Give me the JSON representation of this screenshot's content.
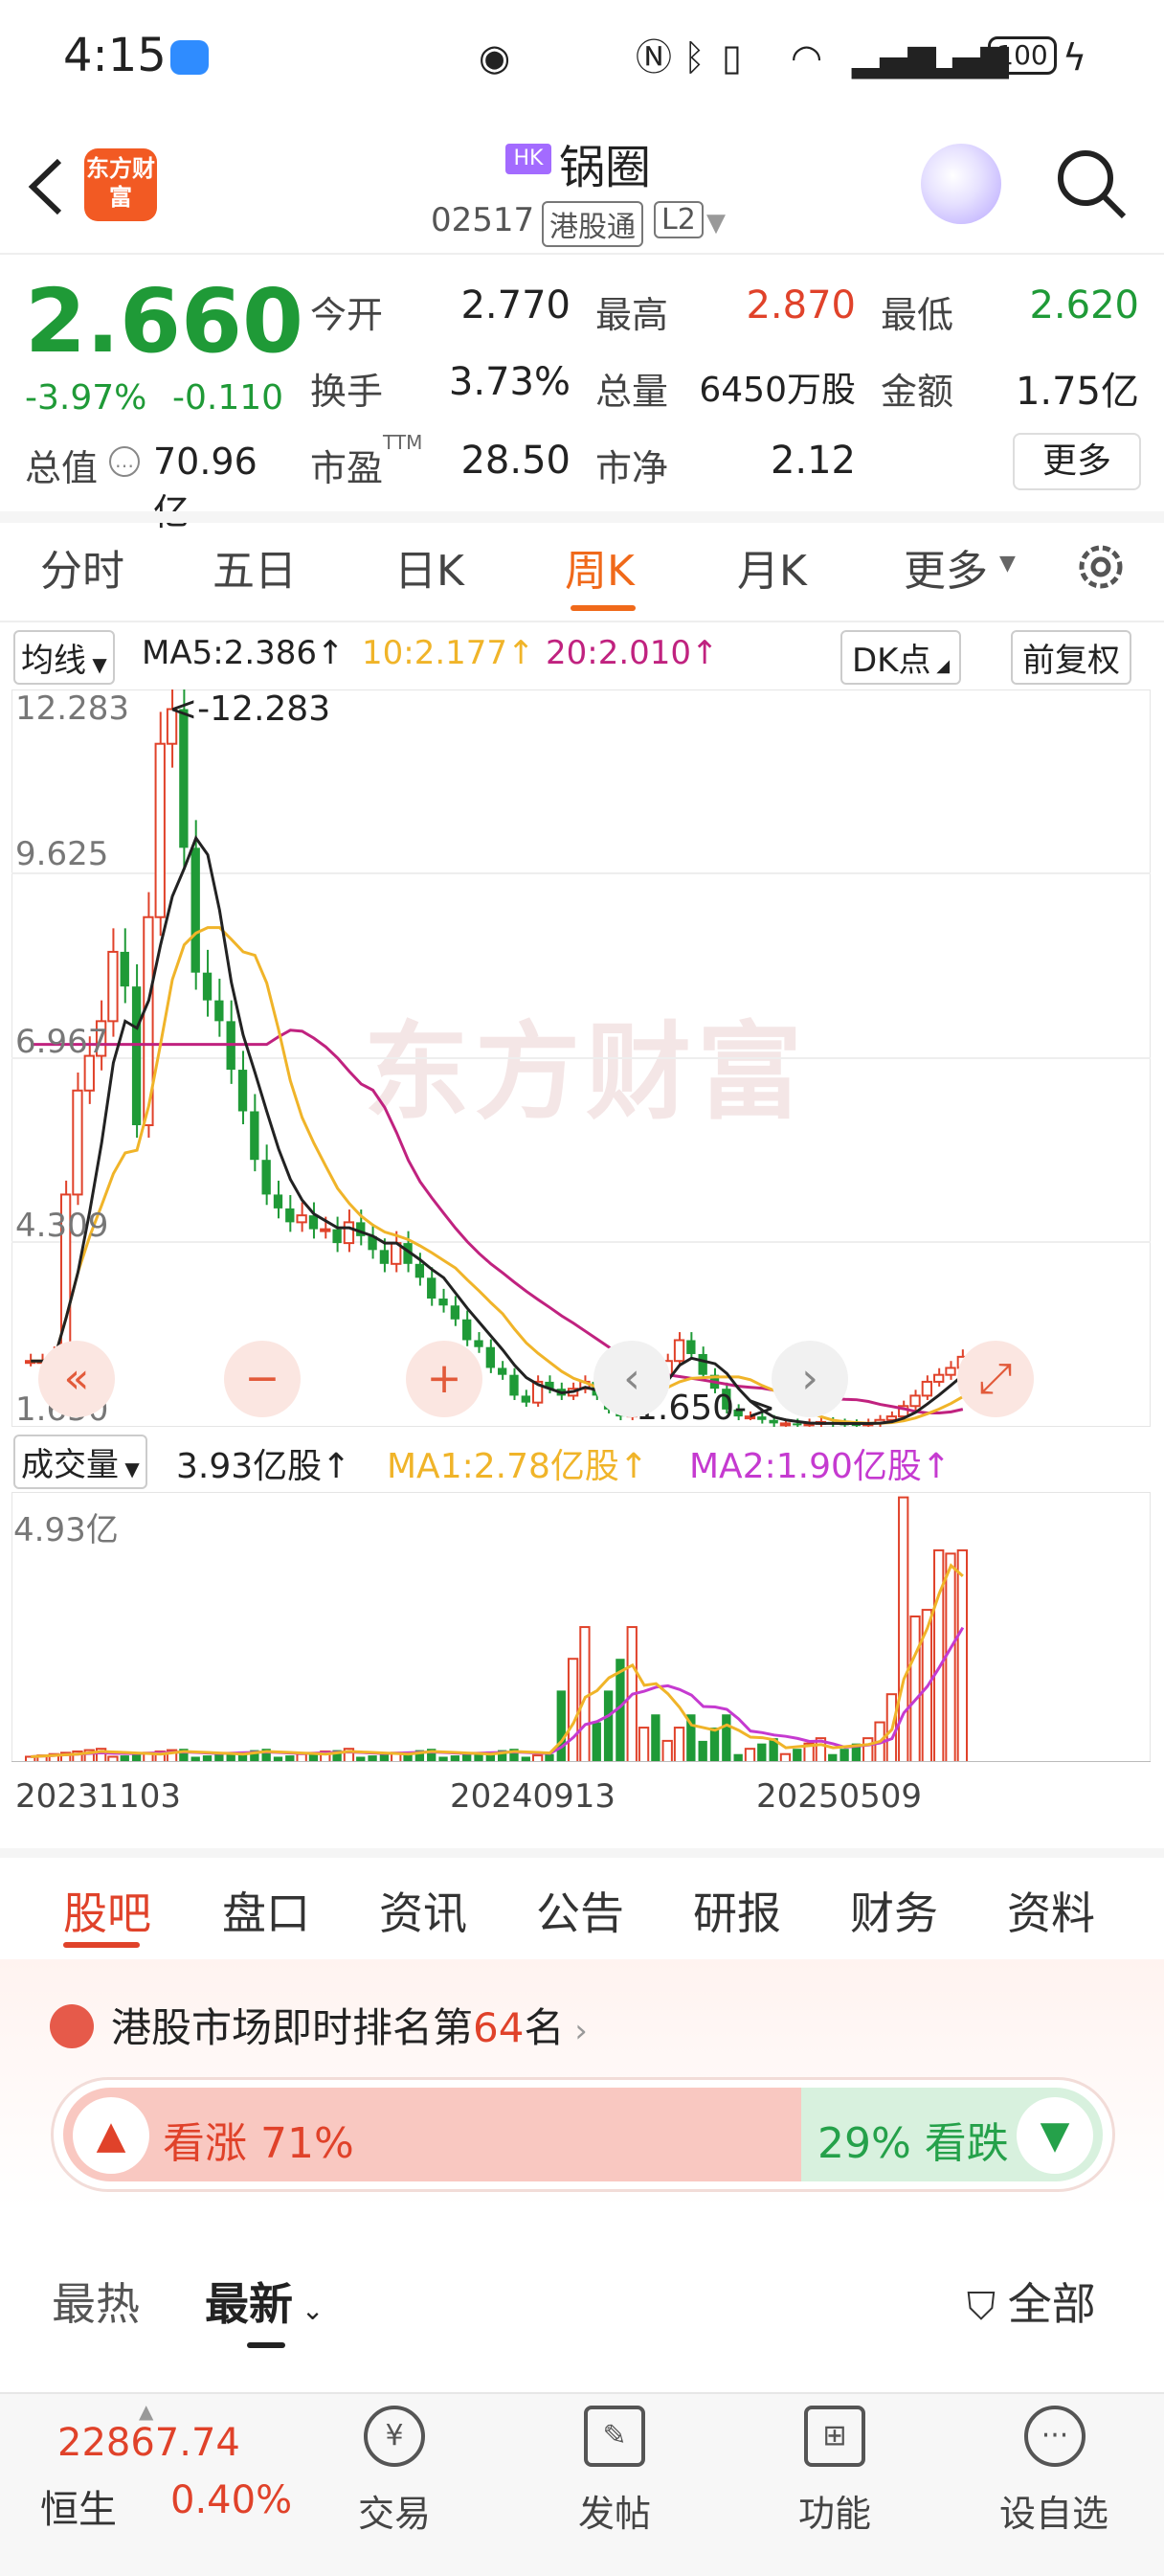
{
  "status_bar": {
    "time": "4:15",
    "battery": "100"
  },
  "header": {
    "badge": "HK",
    "name": "锅圈",
    "code": "02517",
    "connect": "港股通",
    "level": "L2",
    "logo_text": "东方财富"
  },
  "quote": {
    "price": "2.660",
    "change_pct": "-3.97%",
    "change": "-0.110",
    "open_label": "今开",
    "open": "2.770",
    "high_label": "最高",
    "high": "2.870",
    "low_label": "最低",
    "low": "2.620",
    "turnover_label": "换手",
    "turnover": "3.73%",
    "volume_label": "总量",
    "volume": "6450万股",
    "amount_label": "金额",
    "amount": "1.75亿",
    "mcap_label": "总值",
    "mcap": "70.96亿",
    "pe_label": "市盈",
    "pe_sup": "TTM",
    "pe": "28.50",
    "pb_label": "市净",
    "pb": "2.12",
    "more": "更多"
  },
  "chart_tabs": [
    "分时",
    "五日",
    "日K",
    "周K",
    "月K",
    "更多"
  ],
  "ma_row": {
    "selector": "均线",
    "ma5": "MA5:2.386↑",
    "ma10": "10:2.177↑",
    "ma20": "20:2.010↑",
    "dk": "DK点",
    "adjust": "前复权"
  },
  "kline": {
    "y_labels": [
      "12.283",
      "9.625",
      "6.967",
      "4.309",
      "1.650"
    ],
    "max_note": "<-12.283",
    "min_note": "1.650->",
    "watermark": "东方财富"
  },
  "volume_row": {
    "selector": "成交量",
    "vol": "3.93亿股↑",
    "ma1": "MA1:2.78亿股↑",
    "ma2": "MA2:1.90亿股↑",
    "max": "4.93亿"
  },
  "x_dates": [
    "20231103",
    "20240913",
    "20250509"
  ],
  "colors": {
    "up": "#e0422a",
    "down": "#1f9a37",
    "ma5": "#222222",
    "ma10": "#f0b429",
    "ma20": "#c0227f",
    "accent": "#f0691a"
  },
  "lower_tabs": [
    "股吧",
    "盘口",
    "资讯",
    "公告",
    "研报",
    "财务",
    "资料"
  ],
  "rank": {
    "prefix": "港股市场即时排名第",
    "number": "64",
    "suffix": "名"
  },
  "sentiment": {
    "up": "看涨 71%",
    "down": "29% 看跌",
    "up_ratio": 0.71
  },
  "sort": {
    "hot": "最热",
    "new": "最新",
    "filter": "全部"
  },
  "bottom_nav": {
    "index_value": "22867.74",
    "index_name": "恒生",
    "index_pct": "0.40%",
    "items": [
      "交易",
      "发帖",
      "功能",
      "设自选"
    ]
  }
}
